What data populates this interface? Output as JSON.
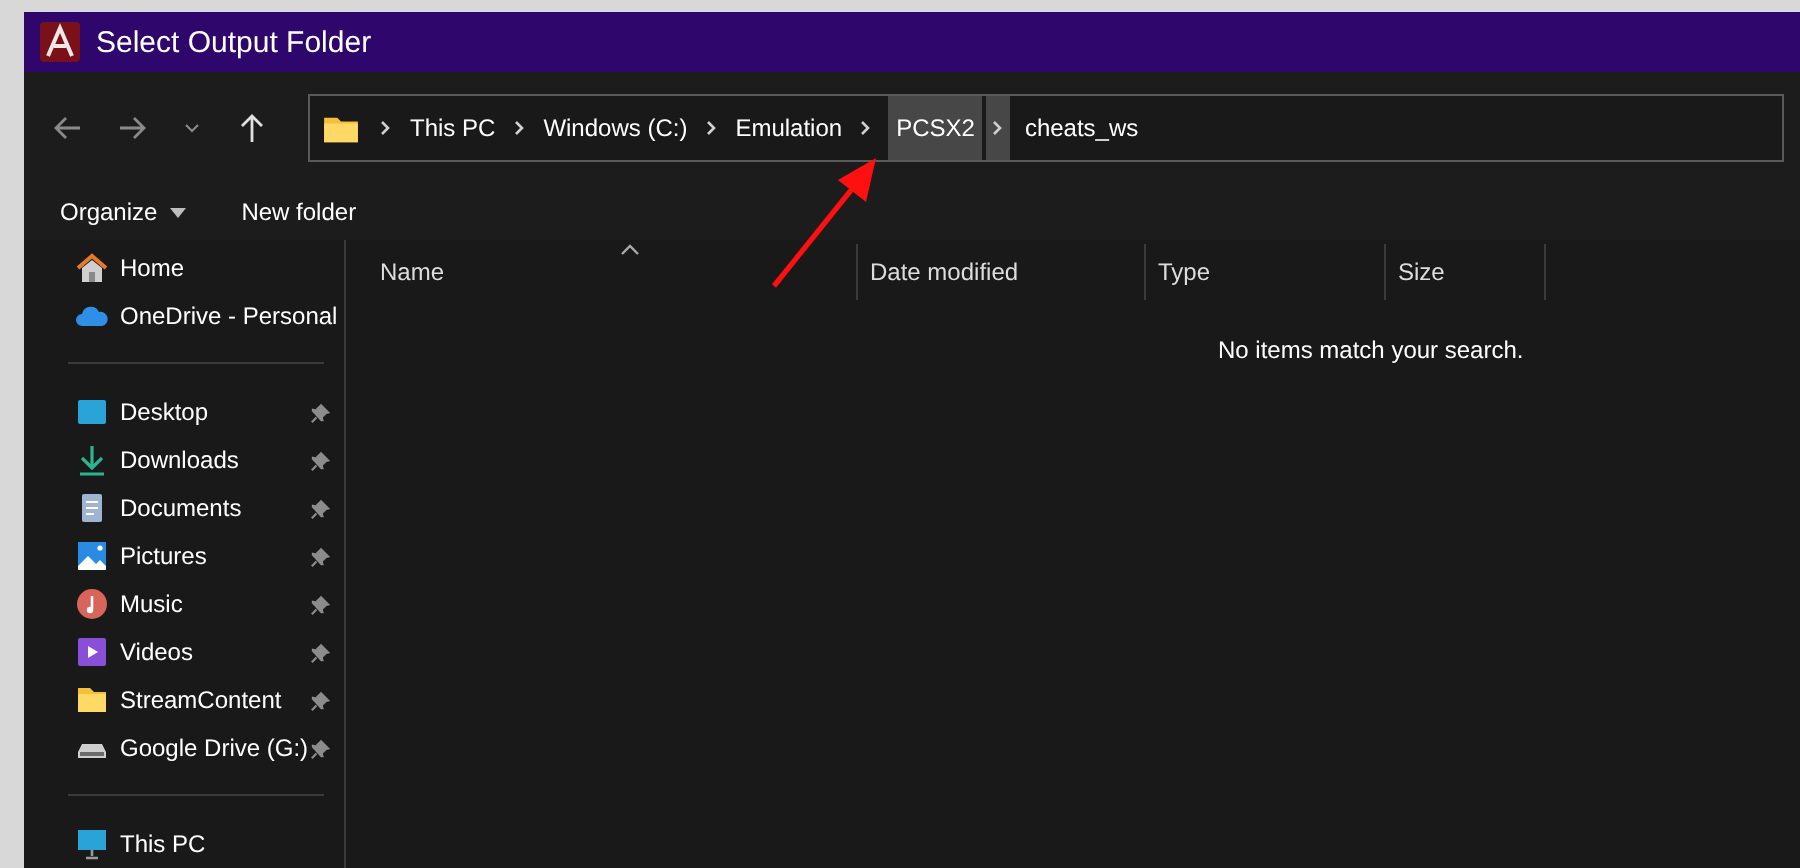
{
  "window": {
    "title": "Select Output Folder"
  },
  "breadcrumbs": [
    {
      "label": "This PC",
      "selected": false
    },
    {
      "label": "Windows (C:)",
      "selected": false
    },
    {
      "label": "Emulation",
      "selected": false
    },
    {
      "label": "PCSX2",
      "selected": true
    },
    {
      "label": "cheats_ws",
      "selected": false
    }
  ],
  "toolbar": [
    {
      "label": "Organize",
      "kind": "menu"
    },
    {
      "label": "New folder",
      "kind": "button"
    }
  ],
  "sidebar": {
    "groups": [
      [
        {
          "label": "Home",
          "kind": "home",
          "pinned": false
        },
        {
          "label": "OneDrive - Personal",
          "kind": "cloud",
          "pinned": false
        }
      ],
      [
        {
          "label": "Desktop",
          "kind": "desktop",
          "pinned": true
        },
        {
          "label": "Downloads",
          "kind": "download",
          "pinned": true
        },
        {
          "label": "Documents",
          "kind": "document",
          "pinned": true
        },
        {
          "label": "Pictures",
          "kind": "pictures",
          "pinned": true
        },
        {
          "label": "Music",
          "kind": "music",
          "pinned": true
        },
        {
          "label": "Videos",
          "kind": "video",
          "pinned": true
        },
        {
          "label": "StreamContent",
          "kind": "folder",
          "pinned": true
        },
        {
          "label": "Google Drive (G:)",
          "kind": "drive",
          "pinned": true
        }
      ],
      [
        {
          "label": "This PC",
          "kind": "pc",
          "pinned": false
        }
      ]
    ]
  },
  "table": {
    "columns": [
      {
        "label": "Name",
        "sorted": true
      },
      {
        "label": "Date modified",
        "sorted": false
      },
      {
        "label": "Type",
        "sorted": false
      },
      {
        "label": "Size",
        "sorted": false
      }
    ],
    "empty_message": "No items match your search."
  },
  "annotation": {
    "kind": "arrow"
  }
}
